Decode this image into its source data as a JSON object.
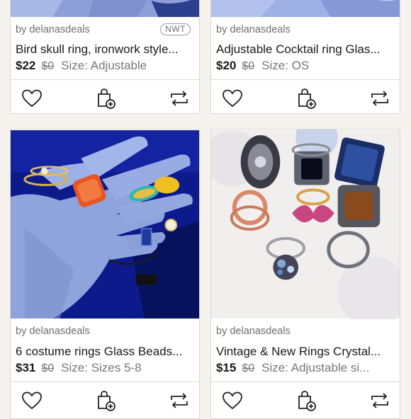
{
  "listings": [
    {
      "seller": "by delanasdeals",
      "badge": "NWT",
      "title": "Bird skull ring, ironwork style...",
      "price": "$22",
      "original_price": "$0",
      "size": "Size: Adjustable"
    },
    {
      "seller": "by delanasdeals",
      "title": "Adjustable Cocktail ring Glas...",
      "price": "$20",
      "original_price": "$0",
      "size": "Size: OS"
    },
    {
      "seller": "by delanasdeals",
      "title": "6 costume rings Glass Beads...",
      "price": "$31",
      "original_price": "$0",
      "size": "Size: Sizes 5-8"
    },
    {
      "seller": "by delanasdeals",
      "title": "Vintage & New Rings Crystal...",
      "price": "$15",
      "original_price": "$0",
      "size": "Size: Adjustable si..."
    }
  ],
  "icons": {
    "like": "heart-icon",
    "bundle": "bag-add-icon",
    "share": "share-arrows-icon"
  },
  "colors": {
    "page_bg": "#f6f3ef",
    "glove_blue": "#8fa3dd",
    "icon_color": "#222222"
  }
}
